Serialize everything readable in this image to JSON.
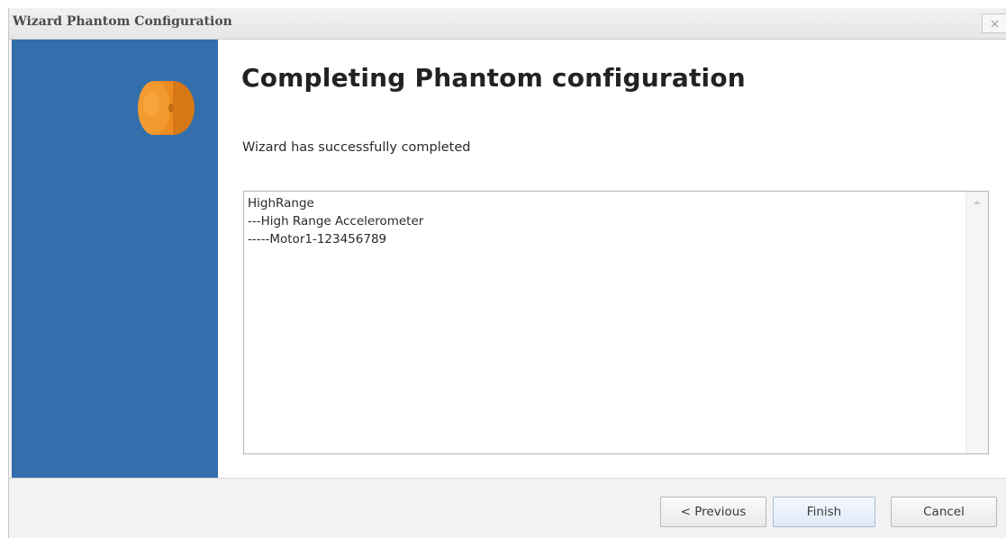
{
  "window": {
    "title": "Wizard Phantom Configuration",
    "close_icon": "close-icon"
  },
  "side_panel": {
    "accent_color": "#336ead",
    "logo_icon": "orange-sensor-logo-icon"
  },
  "main": {
    "heading": "Completing Phantom configuration",
    "status": "Wizard has successfully completed",
    "log_lines": [
      "HighRange",
      "---High Range Accelerometer",
      "-----Motor1-123456789"
    ]
  },
  "footer": {
    "previous_label": "< Previous",
    "finish_label": "Finish",
    "cancel_label": "Cancel"
  }
}
